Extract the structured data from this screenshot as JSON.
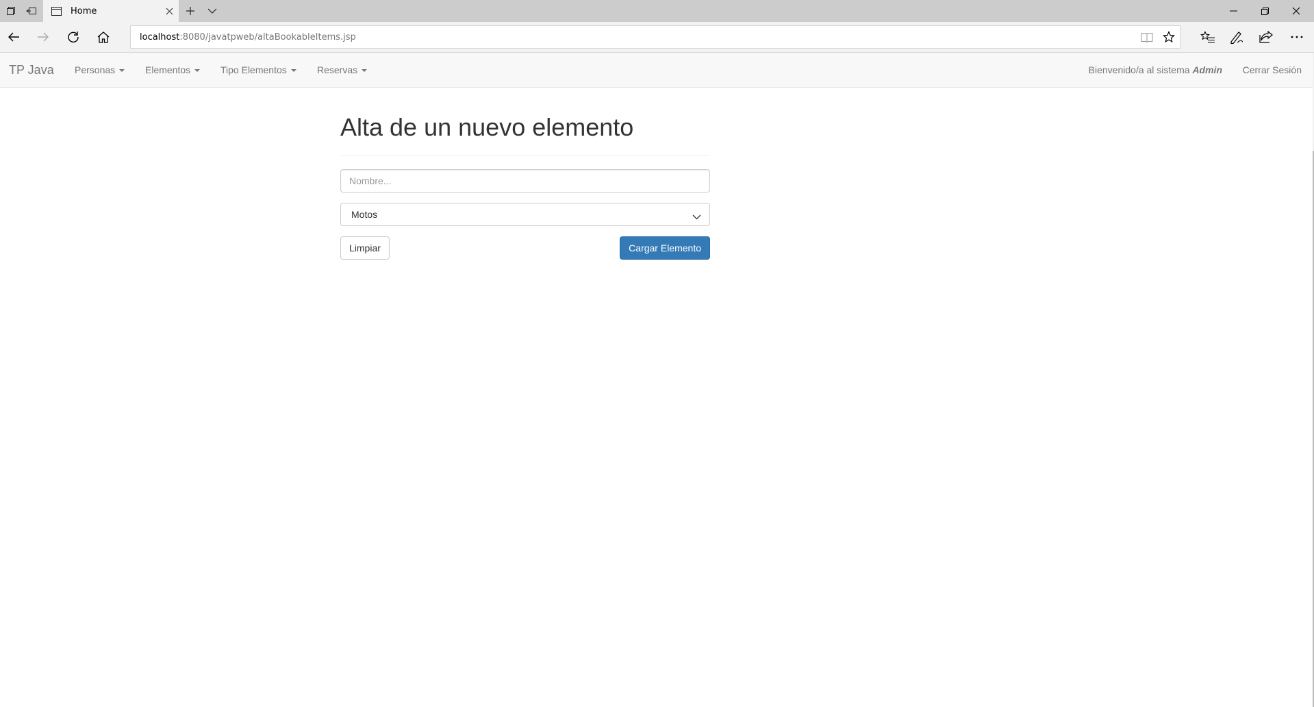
{
  "browser": {
    "tab_title": "Home",
    "url_host": "localhost",
    "url_rest": ":8080/javatpweb/altaBookableItems.jsp"
  },
  "navbar": {
    "brand": "TP Java",
    "menus": [
      {
        "label": "Personas"
      },
      {
        "label": "Elementos"
      },
      {
        "label": "Tipo Elementos"
      },
      {
        "label": "Reservas"
      }
    ],
    "welcome_text": "Bienvenido/a al sistema ",
    "user_name": "Admin",
    "logout_label": "Cerrar Sesión"
  },
  "form": {
    "title": "Alta de un nuevo elemento",
    "name_placeholder": "Nombre...",
    "name_value": "",
    "type_selected": "Motos",
    "clear_label": "Limpiar",
    "submit_label": "Cargar Elemento"
  },
  "colors": {
    "primary": "#337ab7",
    "navbar_bg": "#f8f8f8",
    "chrome_bg": "#f2f2f2",
    "tabstrip_bg": "#cccccc"
  }
}
